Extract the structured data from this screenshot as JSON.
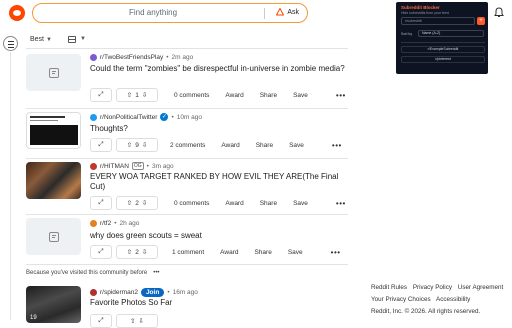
{
  "search": {
    "placeholder": "Find anything",
    "ask_label": "Ask"
  },
  "feed": {
    "sort_label": "Best",
    "view_icon": "card-view-icon"
  },
  "posts": [
    {
      "subreddit": "r/TwoBestFriendsPlay",
      "time": "2m ago",
      "title": "Could the term \"zombies\" be disrespectful in-universe in zombie media?",
      "votes": "1",
      "comments": "0 comments",
      "award": "Award",
      "share": "Share",
      "save": "Save"
    },
    {
      "subreddit": "r/NonPoliticalTwitter",
      "time": "10m ago",
      "title": "Thoughts?",
      "votes": "9",
      "comments": "2 comments",
      "award": "Award",
      "share": "Share",
      "save": "Save"
    },
    {
      "subreddit": "r/HITMAN",
      "flair": "OG",
      "time": "3m ago",
      "title": "EVERY WOA TARGET RANKED BY HOW EVIL THEY ARE(The Final Cut)",
      "votes": "2",
      "comments": "0 comments",
      "award": "Award",
      "share": "Share",
      "save": "Save"
    },
    {
      "subreddit": "r/tf2",
      "time": "2h ago",
      "title": "why does green scouts = sweat",
      "votes": "2",
      "comments": "1 comment",
      "award": "Award",
      "share": "Share",
      "save": "Save"
    },
    {
      "subreddit": "r/spiderman2",
      "join_label": "Join",
      "time": "16m ago",
      "title": "Favorite Photos So Far",
      "votes": "",
      "comments": "",
      "thumb_badge": "19"
    }
  ],
  "recommendation": {
    "text": "Because you've visited this community before",
    "more": "•••"
  },
  "extension": {
    "title": "Subreddit Blocker",
    "subtitle": "Hide subreddits from your feed",
    "input_placeholder": "r/subreddit",
    "add_label": "+",
    "sort_label": "Sort by",
    "sort_value": "Name (A-Z)",
    "blocked": [
      "r/ExampleSubreddit",
      "r/pinterest"
    ]
  },
  "footer": {
    "links": [
      "Reddit Rules",
      "Privacy Policy",
      "User Agreement",
      "Your Privacy Choices",
      "Accessibility"
    ],
    "copyright": "Reddit, Inc. © 2026. All rights reserved."
  },
  "colors": {
    "brand": "#ff4500",
    "search_border": "#f39a3b",
    "join": "#0a66c2",
    "extension_bg": "#0d1321"
  }
}
